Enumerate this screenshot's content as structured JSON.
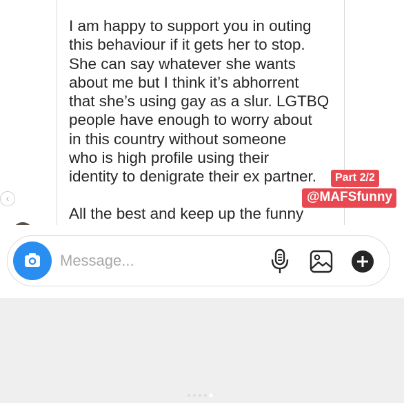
{
  "conversation": {
    "message_part1": "I am happy to support you in outing\nthis behaviour if it gets her to stop.\nShe can say whatever she wants\nabout me but I think it’s abhorrent\nthat she’s using gay as a slur. LGTBQ\npeople have enough to worry about\nin this country without someone\nwho is high profile using their\nidentity to denigrate their ex partner.",
    "message_part2": "All the best and keep up the funny",
    "overlay_part_label": "Part 2/2",
    "overlay_handle": "@MAFSfunny"
  },
  "composer": {
    "placeholder": "Message...",
    "camera_icon": "camera-icon",
    "mic_icon": "microphone-icon",
    "gallery_icon": "gallery-icon",
    "plus_icon": "plus-icon"
  },
  "colors": {
    "accent_blue": "#2a8df0",
    "label_red": "#e8484f",
    "text": "#262626",
    "placeholder": "#a8a8a8"
  }
}
